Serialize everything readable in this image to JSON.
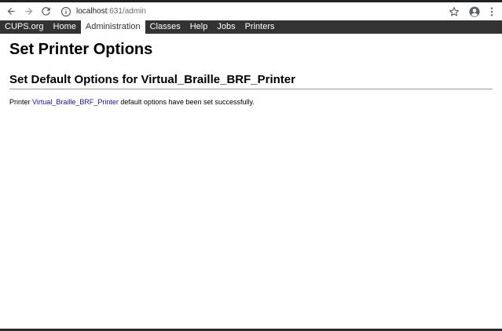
{
  "browser": {
    "url_host": "localhost",
    "url_path": ":631/admin"
  },
  "nav": {
    "items": [
      {
        "label": "CUPS.org",
        "active": false
      },
      {
        "label": "Home",
        "active": false
      },
      {
        "label": "Administration",
        "active": true
      },
      {
        "label": "Classes",
        "active": false
      },
      {
        "label": "Help",
        "active": false
      },
      {
        "label": "Jobs",
        "active": false
      },
      {
        "label": "Printers",
        "active": false
      }
    ]
  },
  "page": {
    "title": "Set Printer Options",
    "subtitle": "Set Default Options for Virtual_Braille_BRF_Printer",
    "message_prefix": "Printer ",
    "printer_link": "Virtual_Braille_BRF_Printer",
    "message_suffix": " default options have been set successfully."
  },
  "colors": {
    "nav_bg": "#333333",
    "link": "#1a0dab"
  }
}
